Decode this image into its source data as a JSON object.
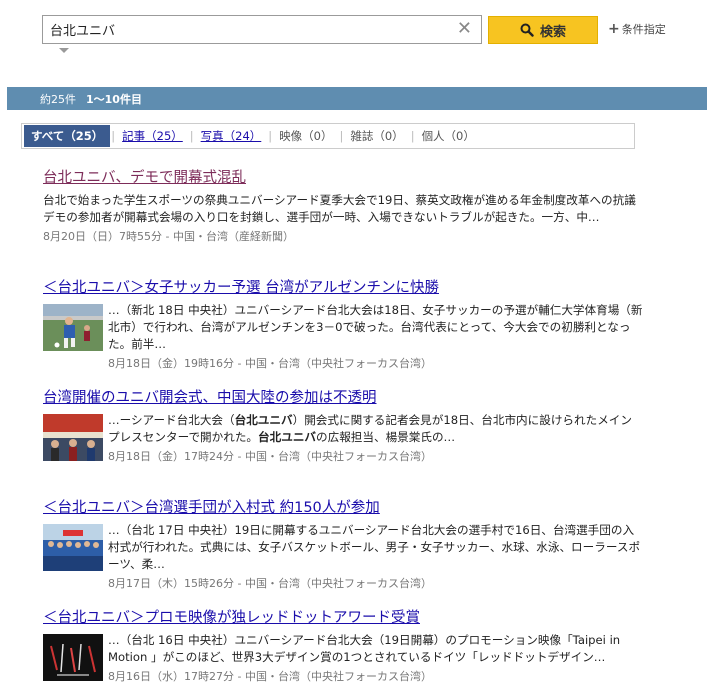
{
  "search": {
    "query": "台北ユニバ",
    "clear_icon": "close-icon",
    "button_label": "検索",
    "button_icon": "search-icon",
    "conditions_label": "条件指定"
  },
  "results_bar": {
    "count": "約25件",
    "range": "1〜10件目"
  },
  "filters": [
    {
      "label": "すべて（25）",
      "state": "active"
    },
    {
      "label": "記事（25）",
      "state": "link"
    },
    {
      "label": "写真（24）",
      "state": "link"
    },
    {
      "label": "映像（0）",
      "state": "disabled"
    },
    {
      "label": "雑誌（0）",
      "state": "disabled"
    },
    {
      "label": "個人（0）",
      "state": "disabled"
    }
  ],
  "articles": [
    {
      "title": "台北ユニバ、デモで開幕式混乱",
      "snippet": "台北で始まった学生スポーツの祭典ユニバーシアード夏季大会で19日、蔡英文政権が進める年金制度改革への抗議デモの参加者が開幕式会場の入り口を封鎖し、選手団が一時、入場できないトラブルが起きた。一方、中…",
      "meta": "8月20日（日）7時55分 - 中国・台湾（産経新聞）"
    },
    {
      "title": "＜台北ユニバ＞女子サッカー予選 台湾がアルゼンチンに快勝",
      "snippet": "…（新北 18日 中央社）ユニバーシアード台北大会は18日、女子サッカーの予選が輔仁大学体育場（新北市）で行われ、台湾がアルゼンチンを3－0で破った。台湾代表にとって、今大会での初勝利となった。前半…",
      "meta": "8月18日（金）19時16分 - 中国・台湾（中央社フォーカス台湾）",
      "thumb": "soccer-photo"
    },
    {
      "title": "台湾開催のユニバ開会式、中国大陸の参加は不透明",
      "snippet_parts": [
        "…ーシアード台北大会（",
        "台北ユニバ",
        "）開会式に関する記者会見が18日、台北市内に設けられたメインプレスセンターで開かれた。",
        "台北ユニバ",
        "の広報担当、楊景棠氏の…"
      ],
      "meta": "8月18日（金）17時24分 - 中国・台湾（中央社フォーカス台湾）",
      "thumb": "press-photo"
    },
    {
      "title": "＜台北ユニバ＞台湾選手団が入村式 約150人が参加",
      "snippet": "…（台北 17日 中央社）19日に開幕するユニバーシアード台北大会の選手村で16日、台湾選手団の入村式が行われた。式典には、女子バスケットボール、男子・女子サッカー、水球、水泳、ローラースポーツ、柔…",
      "meta": "8月17日（木）15時26分 - 中国・台湾（中央社フォーカス台湾）",
      "thumb": "team-photo"
    },
    {
      "title": "＜台北ユニバ＞プロモ映像が独レッドドットアワード受賞",
      "snippet": "…（台北 16日 中央社）ユニバーシアード台北大会（19日開幕）のプロモーション映像「Taipei in Motion 」がこのほど、世界3大デザイン賞の1つとされているドイツ「レッドドットデザイン…",
      "meta": "8月16日（水）17時27分 - 中国・台湾（中央社フォーカス台湾）",
      "thumb": "promo-photo"
    }
  ]
}
